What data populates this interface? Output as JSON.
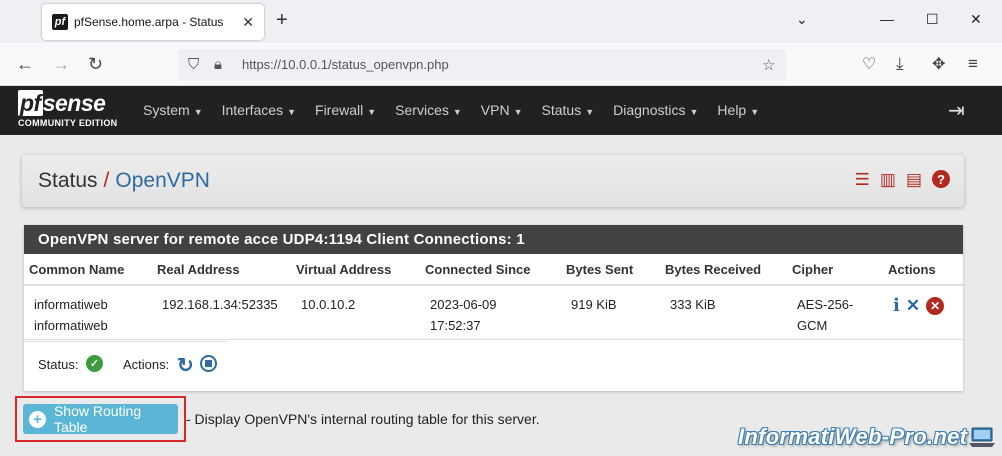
{
  "browser": {
    "tab_title": "pfSense.home.arpa - Status: Op",
    "favicon": "pf",
    "url": "https://10.0.0.1/status_openvpn.php"
  },
  "pfsense": {
    "logo_brand_pf": "pf",
    "logo_brand_rest": "sense",
    "logo_edition": "COMMUNITY EDITION",
    "menu": [
      "System",
      "Interfaces",
      "Firewall",
      "Services",
      "VPN",
      "Status",
      "Diagnostics",
      "Help"
    ]
  },
  "breadcrumb": {
    "parent": "Status",
    "separator": "/",
    "current": "OpenVPN"
  },
  "panel": {
    "title": "OpenVPN server for remote acce UDP4:1194 Client Connections: 1",
    "columns": [
      "Common Name",
      "Real Address",
      "Virtual Address",
      "Connected Since",
      "Bytes Sent",
      "Bytes Received",
      "Cipher",
      "Actions"
    ],
    "rows": [
      {
        "common_name_1": "informatiweb",
        "common_name_2": "informatiweb",
        "real_address": "192.168.1.34:52335",
        "virtual_address": "10.0.10.2",
        "connected_date": "2023-06-09",
        "connected_time": "17:52:37",
        "bytes_sent": "919 KiB",
        "bytes_received": "333 KiB",
        "cipher_1": "AES-256-",
        "cipher_2": "GCM"
      }
    ],
    "status_label": "Status:",
    "actions_label": "Actions:"
  },
  "routing": {
    "button_label": "Show Routing Table",
    "description": "- Display OpenVPN's internal routing table for this server."
  },
  "watermark": "InformatiWeb-Pro.net",
  "colors": {
    "pfsense_red": "#b2291f",
    "link_blue": "#2d6ba0",
    "header_dark": "#212121",
    "button_info": "#5bb6d6",
    "ok_green": "#3d9a3d"
  }
}
